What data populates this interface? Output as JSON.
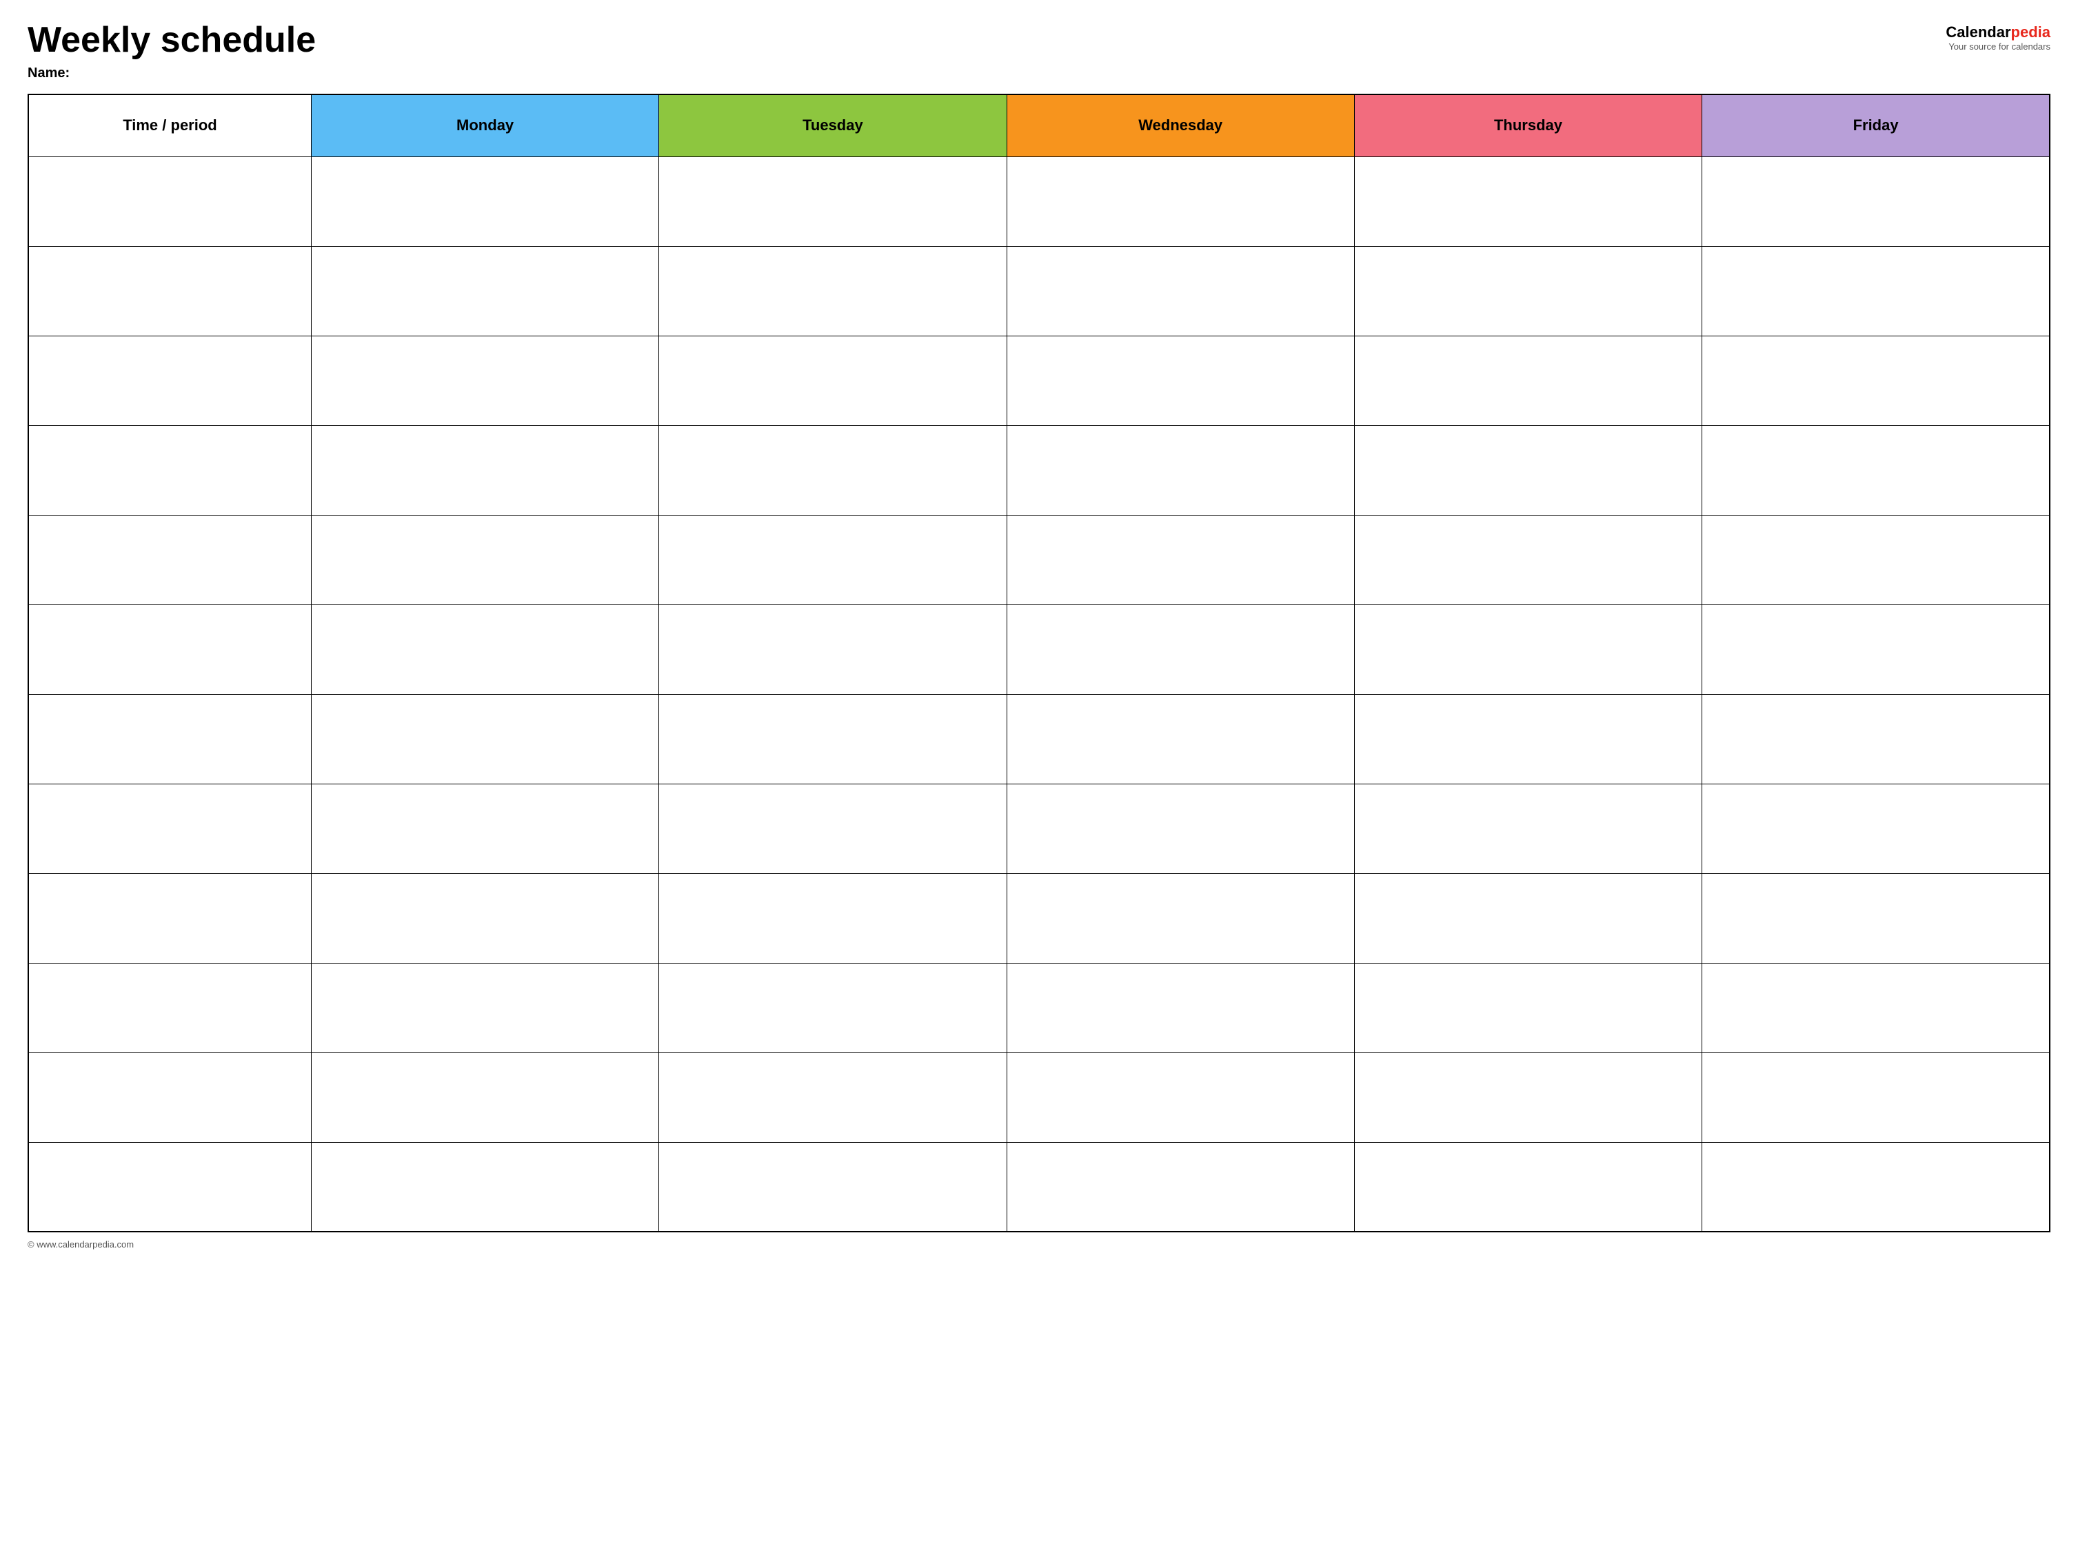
{
  "header": {
    "title": "Weekly schedule",
    "name_label": "Name:",
    "logo_calendar": "Calendar",
    "logo_pedia": "pedia",
    "logo_subtitle": "Your source for calendars",
    "logo_url": "www.calendarpedia.com"
  },
  "table": {
    "columns": [
      {
        "id": "time",
        "label": "Time / period",
        "color": "#ffffff"
      },
      {
        "id": "monday",
        "label": "Monday",
        "color": "#5bbcf5"
      },
      {
        "id": "tuesday",
        "label": "Tuesday",
        "color": "#8dc63f"
      },
      {
        "id": "wednesday",
        "label": "Wednesday",
        "color": "#f7941d"
      },
      {
        "id": "thursday",
        "label": "Thursday",
        "color": "#f26c7e"
      },
      {
        "id": "friday",
        "label": "Friday",
        "color": "#b89fd8"
      }
    ],
    "row_count": 12
  },
  "footer": {
    "url": "© www.calendarpedia.com"
  }
}
